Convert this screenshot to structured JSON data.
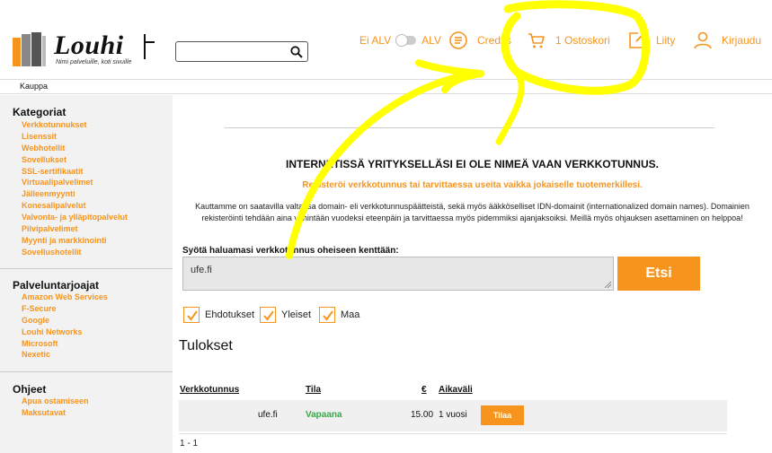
{
  "brand": {
    "name": "Louhi",
    "tagline": "Nimi palveluille, koti sivuille"
  },
  "search": {
    "value": "",
    "placeholder": ""
  },
  "header": {
    "vat_off": "Ei ALV",
    "vat_on": "ALV",
    "credits": "Credits",
    "cart": "1 Ostoskori",
    "join": "Liity",
    "login": "Kirjaudu"
  },
  "nav": {
    "breadcrumb": "Kauppa"
  },
  "sidebar": {
    "categories": {
      "title": "Kategoriat",
      "items": [
        "Verkkotunnukset",
        "Lisenssit",
        "Webhotellit",
        "Sovellukset",
        "SSL-sertifikaatit",
        "Virtuaalipalvelimet",
        "Jälleenmyynti",
        "Konesalipalvelut",
        "Valvonta- ja ylläpitopalvelut",
        "Pilvipalvelimet",
        "Myynti ja markkinointi",
        "Sovellushotellit"
      ]
    },
    "providers": {
      "title": "Palveluntarjoajat",
      "items": [
        "Amazon Web Services",
        "F-Secure",
        "Google",
        "Louhi Networks",
        "Microsoft",
        "Nexetic"
      ]
    },
    "help": {
      "title": "Ohjeet",
      "items": [
        "Apua ostamiseen",
        "Maksutavat"
      ]
    }
  },
  "main": {
    "headline": "INTERNETISSÄ YRITYKSELLÄSI EI OLE NIMEÄ VAAN VERKKOTUNNUS.",
    "subhead": "Rekisteröi verkkotunnus tai tarvittaessa useita vaikka jokaiselle tuotemerkillesi.",
    "description": "Kauttamme on saatavilla valtaosa domain- eli verkkotunnuspäätteistä, sekä myös ääkköselliset IDN-domainit (internationalized domain names). Domainien rekisteröinti tehdään aina vähintään vuodeksi eteenpäin ja tarvittaessa myös pidemmiksi ajanjaksoiksi. Meillä myös ohjauksen asettaminen on helppoa!",
    "prompt": "Syötä haluamasi verkkotunnus oheiseen kenttään:",
    "domain_value": "ufe.fi",
    "search_button": "Etsi",
    "checkboxes": [
      {
        "label": "Ehdotukset",
        "checked": true
      },
      {
        "label": "Yleiset",
        "checked": true
      },
      {
        "label": "Maa",
        "checked": true
      }
    ],
    "results_title": "Tulokset",
    "results": {
      "columns": [
        "Verkkotunnus",
        "Tila",
        "€",
        "Aikaväli"
      ],
      "rows": [
        {
          "domain": "ufe.fi",
          "status": "Vapaana",
          "price": "15.00",
          "period": "1 vuosi",
          "action": "Tilaa"
        }
      ],
      "pager": "1 - 1"
    }
  },
  "colors": {
    "accent": "#f7941d",
    "available": "#3aa84a",
    "annotation": "#ffff00"
  }
}
